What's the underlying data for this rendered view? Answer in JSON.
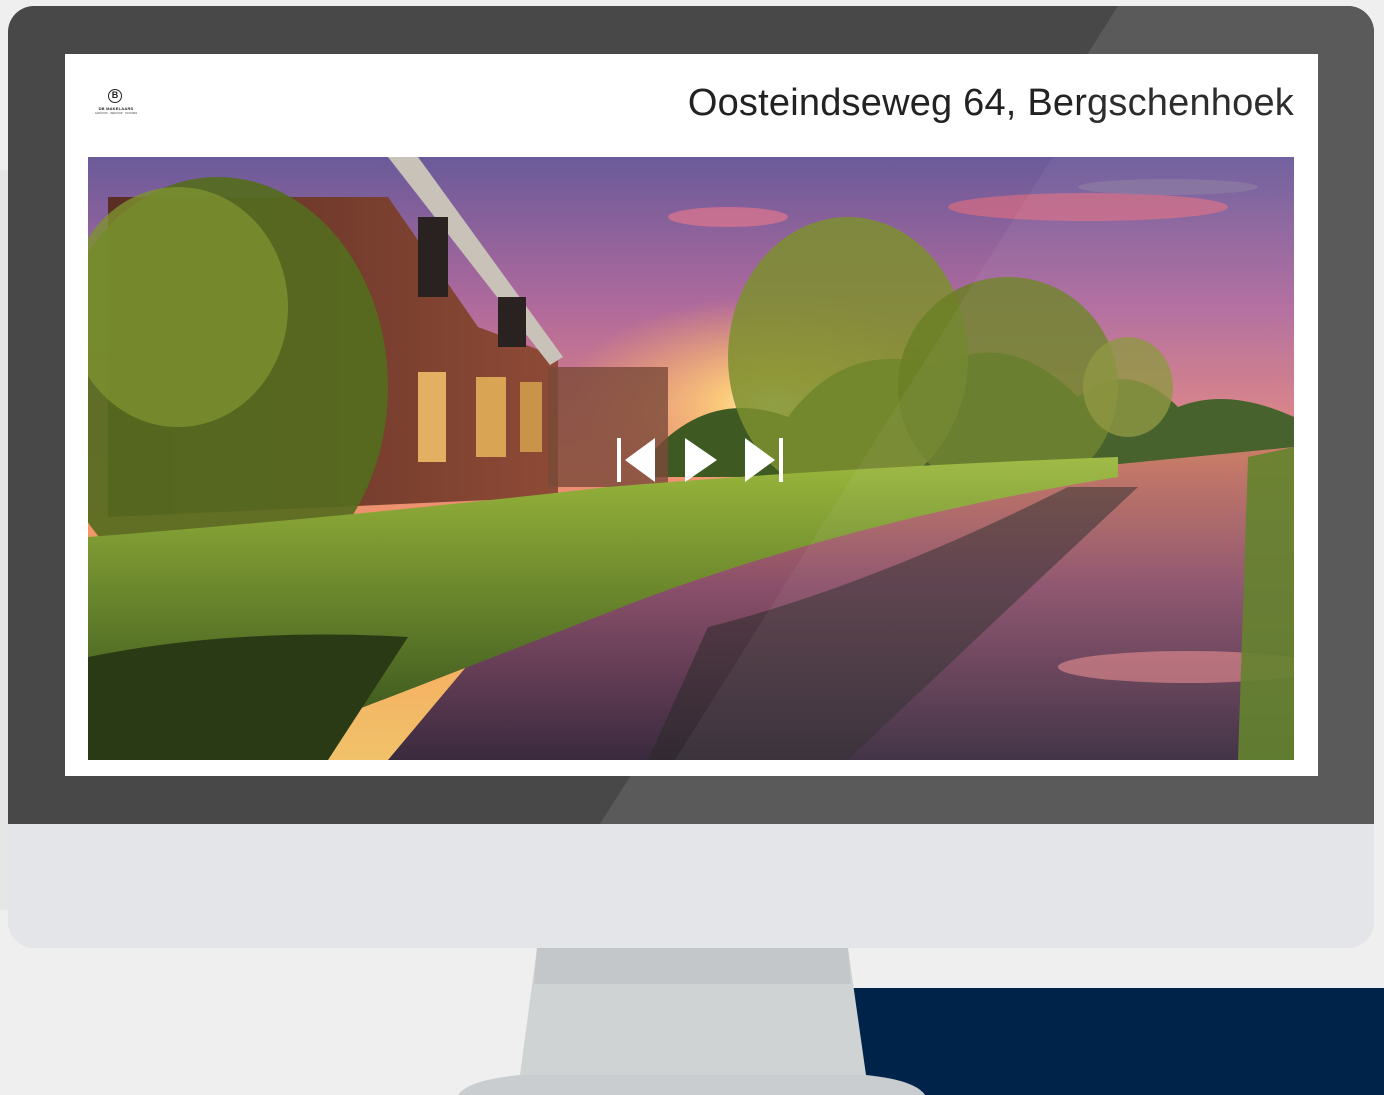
{
  "listing": {
    "address": "Oosteindseweg 64, Bergschenhoek"
  },
  "brand": {
    "logo_mark": "B",
    "logo_name": "DB MAKELAARS",
    "logo_tagline": "AANKOOP · VERKOOP · TAXATIES"
  },
  "slideshow": {
    "controls": [
      "previous-icon",
      "play-icon",
      "next-icon"
    ]
  },
  "colors": {
    "bezel": "#484848",
    "chin": "#e4e5e8",
    "accent_navy": "#00234a"
  }
}
